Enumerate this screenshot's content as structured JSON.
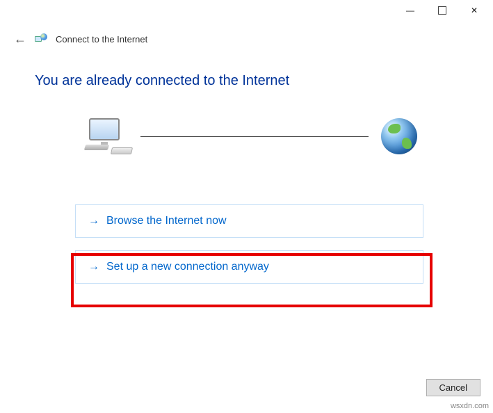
{
  "titlebar": {
    "minimize": "—",
    "close": "✕"
  },
  "header": {
    "back": "←",
    "wizard_title": "Connect to the Internet"
  },
  "main": {
    "heading": "You are already connected to the Internet",
    "option_browse": "Browse the Internet now",
    "option_new": "Set up a new connection anyway"
  },
  "footer": {
    "cancel": "Cancel"
  },
  "watermark": "wsxdn.com"
}
